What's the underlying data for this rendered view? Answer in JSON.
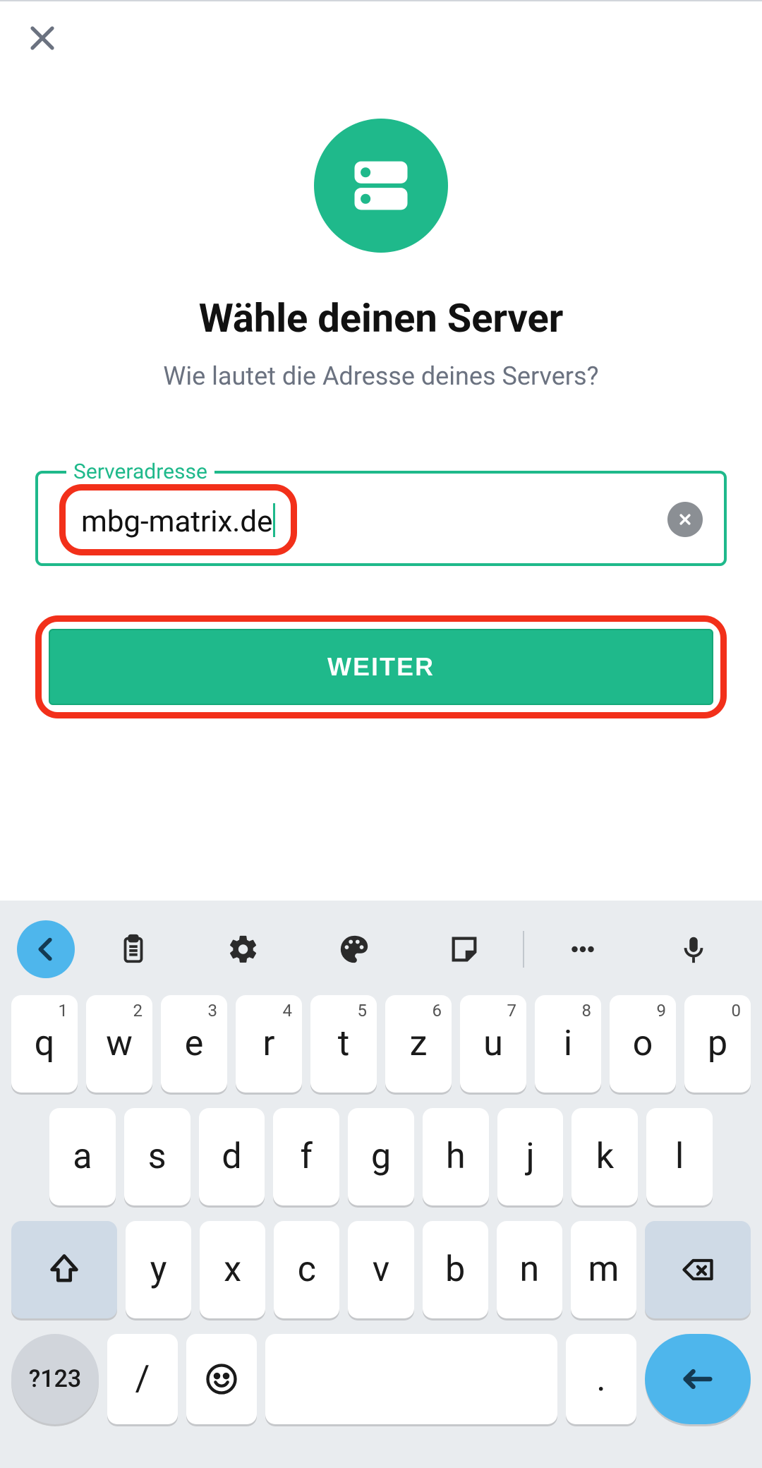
{
  "colors": {
    "accent": "#1fb98b",
    "highlight": "#f2301a",
    "blue": "#4eb6ec"
  },
  "header": {
    "title": "Wähle deinen Server",
    "subtitle": "Wie lautet die Adresse deines Servers?"
  },
  "field": {
    "label": "Serveradresse",
    "value": "mbg-matrix.de"
  },
  "actions": {
    "continue_label": "WEITER"
  },
  "keyboard": {
    "row1": [
      {
        "main": "q",
        "sup": "1"
      },
      {
        "main": "w",
        "sup": "2"
      },
      {
        "main": "e",
        "sup": "3"
      },
      {
        "main": "r",
        "sup": "4"
      },
      {
        "main": "t",
        "sup": "5"
      },
      {
        "main": "z",
        "sup": "6"
      },
      {
        "main": "u",
        "sup": "7"
      },
      {
        "main": "i",
        "sup": "8"
      },
      {
        "main": "o",
        "sup": "9"
      },
      {
        "main": "p",
        "sup": "0"
      }
    ],
    "row2": [
      {
        "main": "a"
      },
      {
        "main": "s"
      },
      {
        "main": "d"
      },
      {
        "main": "f"
      },
      {
        "main": "g"
      },
      {
        "main": "h"
      },
      {
        "main": "j"
      },
      {
        "main": "k"
      },
      {
        "main": "l"
      }
    ],
    "row3": [
      {
        "main": "y"
      },
      {
        "main": "x"
      },
      {
        "main": "c"
      },
      {
        "main": "v"
      },
      {
        "main": "b"
      },
      {
        "main": "n"
      },
      {
        "main": "m"
      }
    ],
    "symbols_label": "?123",
    "slash": "/",
    "dot": "."
  }
}
